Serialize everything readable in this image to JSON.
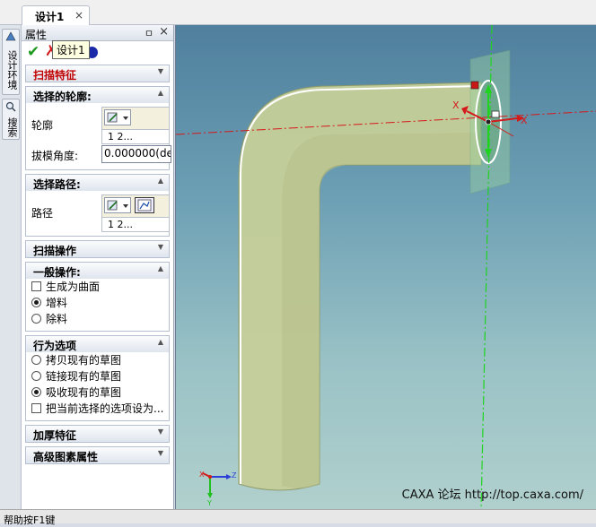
{
  "tab": {
    "title": "设计1",
    "close": "×"
  },
  "side_tabs": {
    "design_env": "设计环境",
    "search": "搜索"
  },
  "panel": {
    "title": "属性",
    "pin": "ㅁ",
    "close": "×",
    "tooltip": "设计1",
    "sections": {
      "sweep_feature": "扫描特征",
      "select_profile": "选择的轮廓:",
      "profile_label": "轮廓",
      "profile_items": "1   2...",
      "draft_label": "拔模角度:",
      "draft_value": "0.000000(de",
      "select_path": "选择路径:",
      "path_label": "路径",
      "path_items": "1   2...",
      "sweep_op": "扫描操作",
      "general_op": "一般操作:",
      "gen_surface": "生成为曲面",
      "add_material": "增料",
      "remove_material": "除料",
      "behavior": "行为选项",
      "copy_sketch": "拷贝现有的草图",
      "link_sketch": "链接现有的草图",
      "absorb_sketch": "吸收现有的草图",
      "set_default": "把当前选择的选项设为...",
      "thicken": "加厚特征",
      "advanced": "高级图素属性"
    }
  },
  "viewport": {
    "axis_x": "X",
    "axis_y": "Y",
    "axis_z": "Z",
    "watermark": "CAXA 论坛  http://top.caxa.com/"
  },
  "status": "帮助按F1键"
}
